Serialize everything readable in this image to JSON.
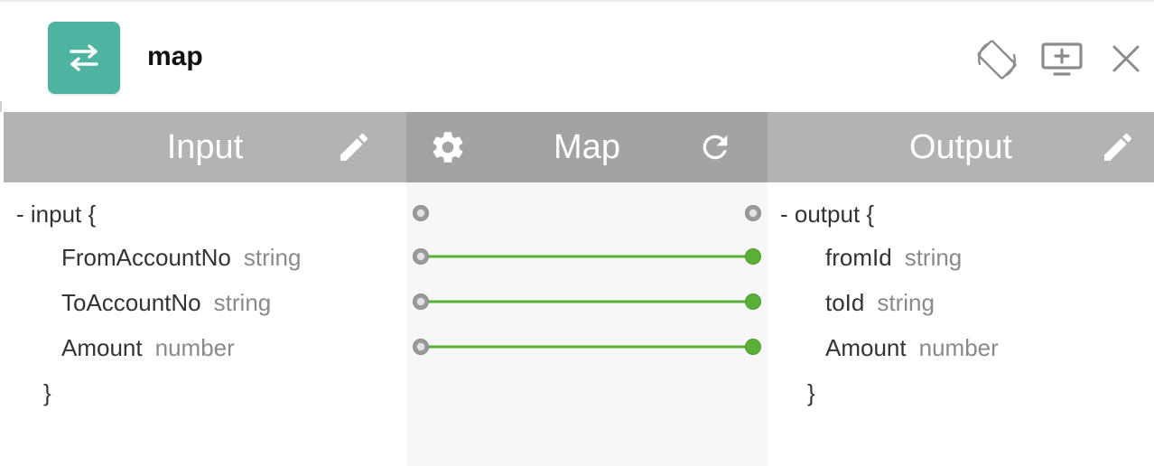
{
  "header": {
    "title": "map",
    "icons": {
      "app": "swap-arrows-icon",
      "rotate": "screen-rotate-icon",
      "present": "add-screen-icon",
      "close": "close-icon"
    },
    "accent_color": "#4fb3a2"
  },
  "columns": {
    "input": {
      "label": "Input",
      "icon": "pencil-icon"
    },
    "map": {
      "label": "Map",
      "left_icon": "gear-icon",
      "right_icon": "refresh-icon"
    },
    "output": {
      "label": "Output",
      "icon": "pencil-icon"
    }
  },
  "input_schema": {
    "open": "- input {",
    "fields": [
      {
        "name": "FromAccountNo",
        "type": "string"
      },
      {
        "name": "ToAccountNo",
        "type": "string"
      },
      {
        "name": "Amount",
        "type": "number"
      }
    ],
    "close": "}"
  },
  "output_schema": {
    "open": "- output {",
    "fields": [
      {
        "name": "fromId",
        "type": "string"
      },
      {
        "name": "toId",
        "type": "string"
      },
      {
        "name": "Amount",
        "type": "number"
      }
    ],
    "close": "}"
  },
  "mappings": [
    {
      "from": "FromAccountNo",
      "to": "fromId"
    },
    {
      "from": "ToAccountNo",
      "to": "toId"
    },
    {
      "from": "Amount",
      "to": "Amount"
    }
  ],
  "colors": {
    "connected": "#5aaf37",
    "port": "#9a9a9a"
  }
}
